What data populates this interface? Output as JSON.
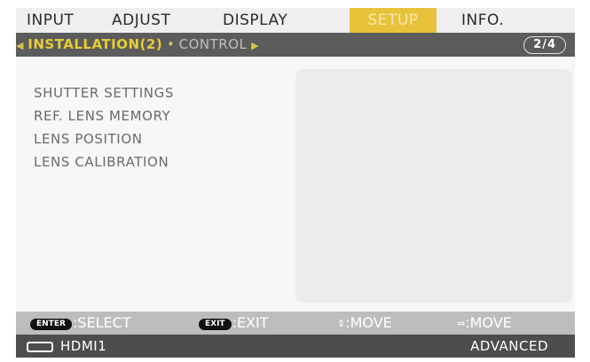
{
  "tabs": [
    {
      "label": "INPUT",
      "active": false
    },
    {
      "label": "ADJUST",
      "active": false
    },
    {
      "label": "DISPLAY",
      "active": false
    },
    {
      "label": "SETUP",
      "active": true
    },
    {
      "label": "INFO.",
      "active": false
    }
  ],
  "subheader": {
    "current": "INSTALLATION(2)",
    "separator": "•",
    "next": "CONTROL",
    "page": "2/4"
  },
  "menu_items": [
    "SHUTTER SETTINGS",
    "REF. LENS MEMORY",
    "LENS POSITION",
    "LENS CALIBRATION"
  ],
  "key_guide": {
    "enter_badge": "ENTER",
    "enter_label": ":SELECT",
    "exit_badge": "EXIT",
    "exit_label": ":EXIT",
    "move_vertical_label": "MOVE",
    "move_horizontal_label": "MOVE"
  },
  "status": {
    "input_icon": "hdmi-connector-icon",
    "input_label": "HDMI1",
    "mode_label": "ADVANCED"
  },
  "colors": {
    "active_tab": "#e8c23a",
    "subheader_bg": "#5c5c5c",
    "subheader_highlight": "#e6cd35",
    "keybar_bg": "#bdbdbd",
    "statusbar_bg": "#4d4d4d"
  }
}
